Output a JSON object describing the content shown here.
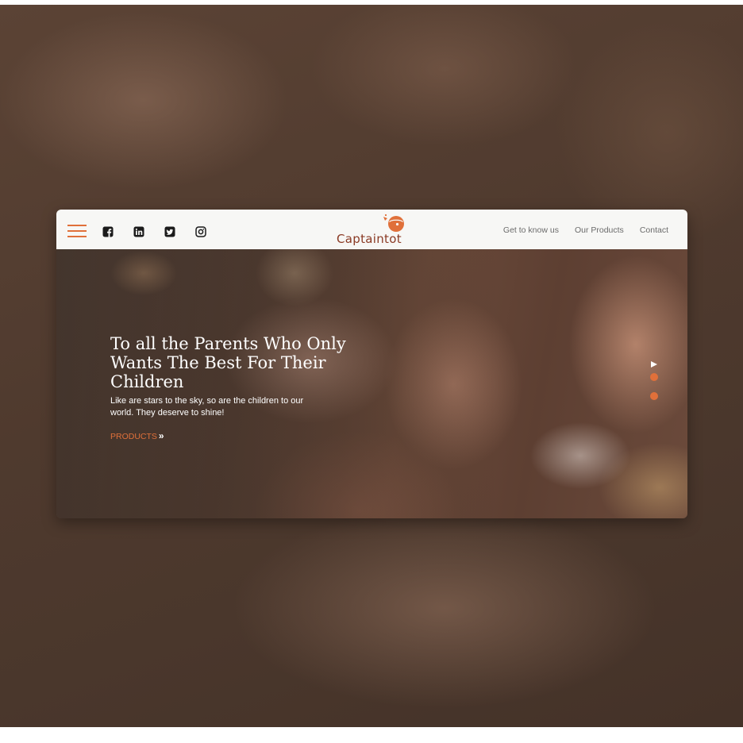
{
  "brand": {
    "name": "Captaintot",
    "accent_color": "#e0703a",
    "logo_text_color": "#8a3a24"
  },
  "header": {
    "menu_icon": "hamburger-menu-icon",
    "social_icons": [
      "facebook-icon",
      "linkedin-icon",
      "twitter-icon",
      "instagram-icon"
    ],
    "nav_links": [
      "Get to know us",
      "Our Products",
      "Contact"
    ]
  },
  "hero": {
    "title": "To all the Parents Who Only Wants The Best For Their Children",
    "subtitle": "Like are stars to the sky, so are the children to our world. They deserve to shine!",
    "cta_label": "PRODUCTS",
    "cta_icon": "double-chevron-right-icon",
    "slider": {
      "play_icon": "play-icon",
      "dot_count": 2
    }
  }
}
